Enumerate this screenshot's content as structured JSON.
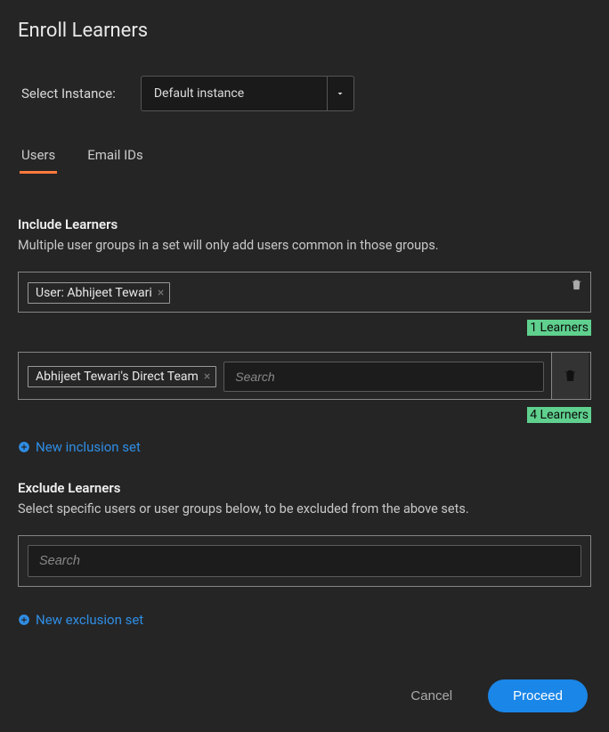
{
  "page_title": "Enroll Learners",
  "instance": {
    "label": "Select Instance:",
    "selected": "Default instance"
  },
  "tabs": {
    "users": "Users",
    "email_ids": "Email IDs",
    "active": "users"
  },
  "include": {
    "title": "Include Learners",
    "desc": "Multiple user groups in a set will only add users common in those groups.",
    "sets": [
      {
        "tags": [
          {
            "label": "User: Abhijeet Tewari"
          }
        ],
        "count_label": "1 Learners",
        "show_search": false,
        "trash_style": "corner"
      },
      {
        "tags": [
          {
            "label": "Abhijeet Tewari's Direct Team"
          }
        ],
        "count_label": "4 Learners",
        "show_search": true,
        "search_placeholder": "Search",
        "trash_style": "side"
      }
    ],
    "add_link": "New inclusion set"
  },
  "exclude": {
    "title": "Exclude Learners",
    "desc": "Select specific users or user groups below, to be excluded from the above sets.",
    "search_placeholder": "Search",
    "add_link": "New exclusion set"
  },
  "footer": {
    "cancel": "Cancel",
    "proceed": "Proceed"
  }
}
